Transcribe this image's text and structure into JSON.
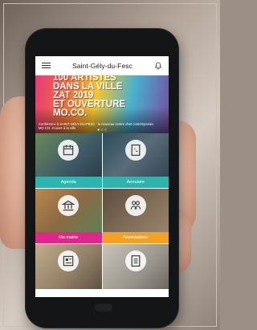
{
  "app": {
    "title": "Saint-Gély-du-Fesc"
  },
  "icons": {
    "menu": "menu-icon",
    "notifications": "bell-icon"
  },
  "banner": {
    "title_lines": [
      "100 ARTISTES",
      "DANS LA VILLE",
      "ZAT 2019",
      "ET OUVERTURE",
      "MO.CO."
    ],
    "caption": "Conférence à SAINT-GÉLY-DU-FESC : le nouveau centre d'art contemporain MO.CO. s'ouvre à la ville",
    "dots": "● ○ ○"
  },
  "tiles": [
    {
      "label": "Agenda",
      "color": "#2cb5b0",
      "icon": "calendar-icon"
    },
    {
      "label": "Annuaire",
      "color": "#2fb4ad",
      "icon": "phone-book-icon"
    },
    {
      "label": "Ma mairie",
      "color": "#e0268b",
      "icon": "town-hall-icon"
    },
    {
      "label": "Associations",
      "color": "#f2a122",
      "icon": "people-icon"
    },
    {
      "label": "",
      "color": "#ffffff",
      "icon": "newspaper-icon"
    },
    {
      "label": "",
      "color": "#ffffff",
      "icon": "checklist-icon"
    }
  ]
}
